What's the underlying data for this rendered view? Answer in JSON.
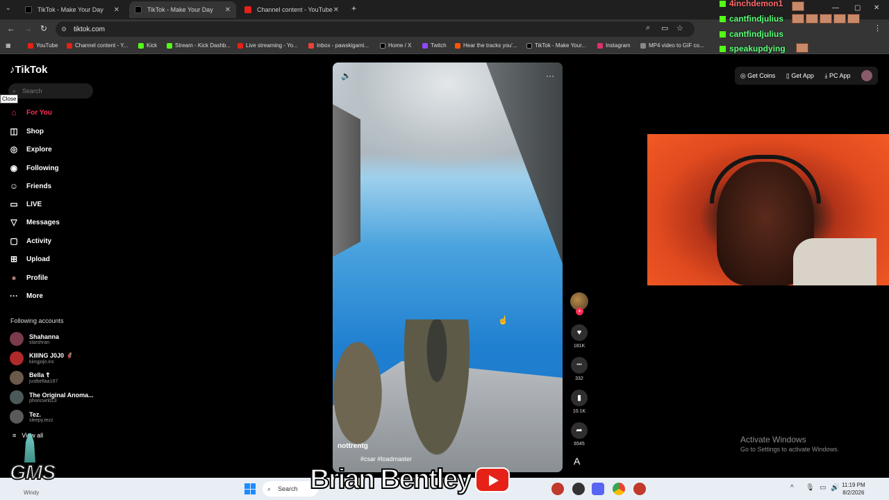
{
  "browser": {
    "tabs": [
      {
        "label": "TikTok - Make Your Day",
        "color": "#000000"
      },
      {
        "label": "TikTok - Make Your Day",
        "color": "#000000"
      },
      {
        "label": "Channel content - YouTube",
        "color": "#e62117"
      }
    ],
    "url": "tiktok.com",
    "bookmarks": [
      {
        "label": "YouTube",
        "color": "#e62117"
      },
      {
        "label": "Channel content - Y...",
        "color": "#e62117"
      },
      {
        "label": "Kick",
        "color": "#53fc18"
      },
      {
        "label": "Stream - Kick Dashb...",
        "color": "#53fc18"
      },
      {
        "label": "Live streaming - Yo...",
        "color": "#e62117"
      },
      {
        "label": "Inbox - pawskigami...",
        "color": "#ea4335"
      },
      {
        "label": "Home / X",
        "color": "#000000"
      },
      {
        "label": "Twitch",
        "color": "#9146ff"
      },
      {
        "label": "Hear the tracks you'...",
        "color": "#ff5500"
      },
      {
        "label": "TikTok - Make Your...",
        "color": "#000000"
      },
      {
        "label": "Instagram",
        "color": "#e1306c"
      },
      {
        "label": "MP4 video to GIF co...",
        "color": "#888888"
      }
    ]
  },
  "tiktok": {
    "logo": "TikTok",
    "search_placeholder": "Search",
    "close_tooltip": "Close",
    "nav": [
      {
        "label": "For You",
        "icon": "home-icon",
        "glyph": "⌂"
      },
      {
        "label": "Shop",
        "icon": "bag-icon",
        "glyph": "◫"
      },
      {
        "label": "Explore",
        "icon": "compass-icon",
        "glyph": "◎"
      },
      {
        "label": "Following",
        "icon": "following-icon",
        "glyph": "◉"
      },
      {
        "label": "Friends",
        "icon": "friends-icon",
        "glyph": "☺"
      },
      {
        "label": "LIVE",
        "icon": "live-icon",
        "glyph": "▭"
      },
      {
        "label": "Messages",
        "icon": "messages-icon",
        "glyph": "▽"
      },
      {
        "label": "Activity",
        "icon": "activity-icon",
        "glyph": "▢"
      },
      {
        "label": "Upload",
        "icon": "upload-icon",
        "glyph": "⊞"
      },
      {
        "label": "Profile",
        "icon": "profile-icon",
        "glyph": "●"
      },
      {
        "label": "More",
        "icon": "more-icon",
        "glyph": "···"
      }
    ],
    "following_title": "Following accounts",
    "accounts": [
      {
        "name": "Shahanna",
        "handle": "starshran",
        "color": "#7a3b4a"
      },
      {
        "name": "KIIING J0J0 🦸",
        "handle": "kiingjojo.inc",
        "color": "#b02a2a"
      },
      {
        "name": "Bella ☦",
        "handle": "justbellaa187",
        "color": "#6a5a4a"
      },
      {
        "name": "The Original Anoma...",
        "handle": "phoricwrld13",
        "color": "#4a5a5a"
      },
      {
        "name": "Tez.",
        "handle": "sleepy.tezz",
        "color": "#5a5a5a"
      }
    ],
    "view_all": "View all",
    "video": {
      "username": "nottrentg",
      "tags": "#csar #loadmaster"
    },
    "actions": [
      {
        "icon": "heart-icon",
        "glyph": "♥",
        "count": "181K"
      },
      {
        "icon": "comment-icon",
        "glyph": "•••",
        "count": "332"
      },
      {
        "icon": "bookmark-icon",
        "glyph": "▮",
        "count": "10.1K"
      },
      {
        "icon": "share-icon",
        "glyph": "➦",
        "count": "6545"
      }
    ],
    "top_buttons": {
      "coins": "Get Coins",
      "app": "Get App",
      "pc": "PC App"
    }
  },
  "chat": [
    {
      "user": "4inchdemon1"
    },
    {
      "user": "cantfindjulius"
    },
    {
      "user": "cantfindjulius"
    },
    {
      "user": "speakupdying"
    }
  ],
  "activate": {
    "title": "Activate Windows",
    "sub": "Go to Settings to activate Windows."
  },
  "taskbar": {
    "search": "Search",
    "time": "11:19 PM",
    "date": "8/2/2026",
    "weather": "Windy"
  },
  "overlay": {
    "gms": "GMS",
    "streamer": "Brian Bentley"
  }
}
